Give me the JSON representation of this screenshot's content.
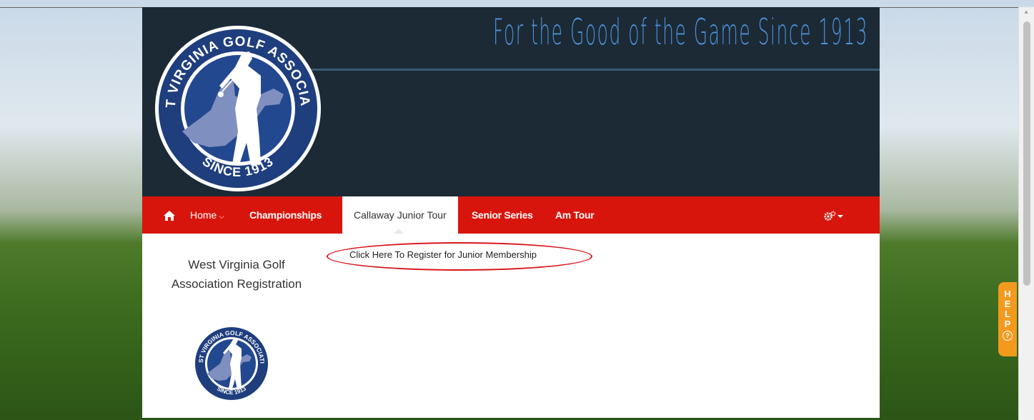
{
  "banner": {
    "tagline": "For the Good of the Game Since 1913",
    "logo": {
      "top_text": "WEST VIRGINIA GOLF ASSOCIATION",
      "bottom_text": "SINCE 1913"
    }
  },
  "nav": {
    "home_icon": "home-icon",
    "items": [
      {
        "label": "Home",
        "has_caret": true
      },
      {
        "label": "Championships"
      },
      {
        "label": "Callaway Junior Tour",
        "active": true
      },
      {
        "label": "Senior Series"
      },
      {
        "label": "Am Tour"
      }
    ],
    "settings_icon": "gears-icon"
  },
  "sidebar": {
    "title": "West Virginia Golf Association Registration"
  },
  "main": {
    "register_link": "Click Here To Register for Junior Membership"
  },
  "help_tab": {
    "letters": [
      "H",
      "E",
      "L",
      "P"
    ],
    "icon": "question-circle-icon"
  },
  "colors": {
    "nav_red": "#d8150c",
    "banner_dark": "#1b2a35",
    "tagline_blue": "#4d8fd6",
    "help_orange": "#f39a1e",
    "annotation_red": "#d9141b"
  }
}
